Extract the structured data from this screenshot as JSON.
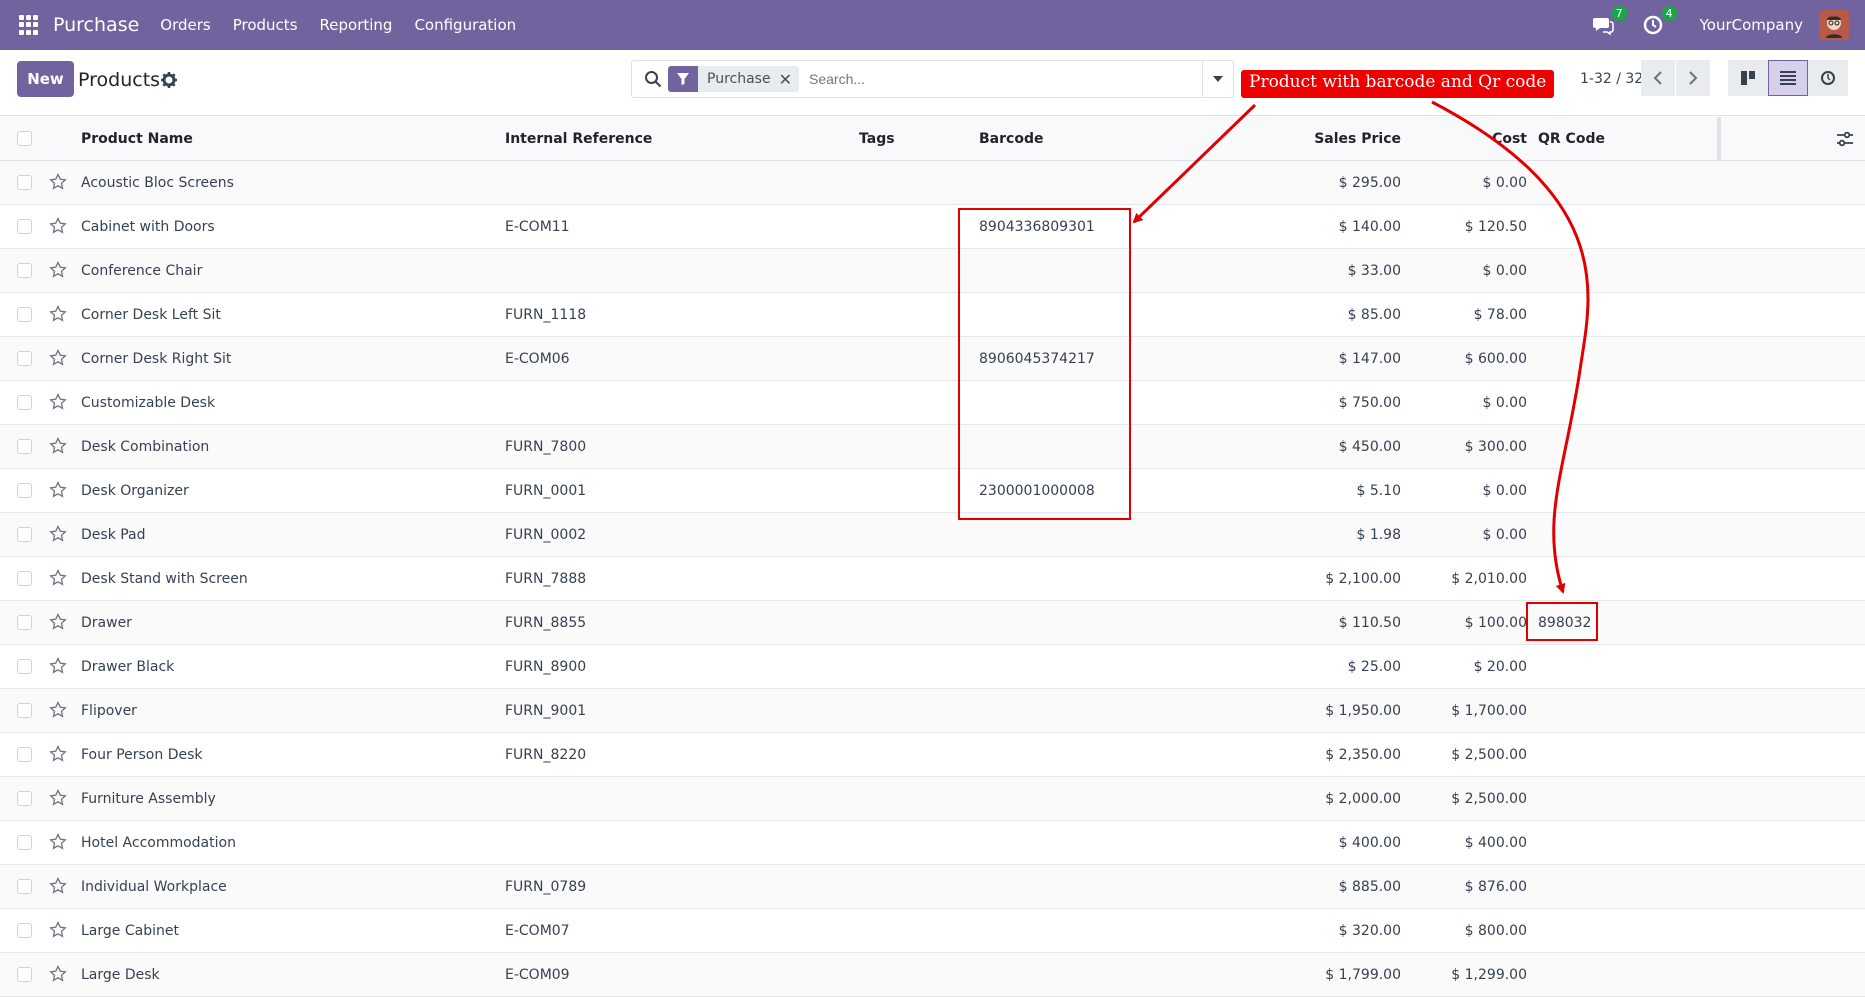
{
  "navbar": {
    "app_name": "Purchase",
    "menus": [
      "Orders",
      "Products",
      "Reporting",
      "Configuration"
    ],
    "messages_count": "7",
    "activities_count": "4",
    "company": "YourCompany"
  },
  "control": {
    "new_label": "New",
    "title": "Products",
    "facet_label": "Purchase",
    "search_placeholder": "Search...",
    "pager": "1-32 / 32"
  },
  "columns": {
    "name": "Product Name",
    "ref": "Internal Reference",
    "tags": "Tags",
    "barcode": "Barcode",
    "price": "Sales Price",
    "cost": "Cost",
    "qr": "QR Code"
  },
  "annotation": {
    "callout": "Product with barcode and Qr code"
  },
  "rows": [
    {
      "name": "Acoustic Bloc Screens",
      "ref": "",
      "barcode": "",
      "price": "$ 295.00",
      "cost": "$ 0.00",
      "qr": ""
    },
    {
      "name": "Cabinet with Doors",
      "ref": "E-COM11",
      "barcode": "8904336809301",
      "price": "$ 140.00",
      "cost": "$ 120.50",
      "qr": ""
    },
    {
      "name": "Conference Chair",
      "ref": "",
      "barcode": "",
      "price": "$ 33.00",
      "cost": "$ 0.00",
      "qr": ""
    },
    {
      "name": "Corner Desk Left Sit",
      "ref": "FURN_1118",
      "barcode": "",
      "price": "$ 85.00",
      "cost": "$ 78.00",
      "qr": ""
    },
    {
      "name": "Corner Desk Right Sit",
      "ref": "E-COM06",
      "barcode": "8906045374217",
      "price": "$ 147.00",
      "cost": "$ 600.00",
      "qr": ""
    },
    {
      "name": "Customizable Desk",
      "ref": "",
      "barcode": "",
      "price": "$ 750.00",
      "cost": "$ 0.00",
      "qr": ""
    },
    {
      "name": "Desk Combination",
      "ref": "FURN_7800",
      "barcode": "",
      "price": "$ 450.00",
      "cost": "$ 300.00",
      "qr": ""
    },
    {
      "name": "Desk Organizer",
      "ref": "FURN_0001",
      "barcode": "2300001000008",
      "price": "$ 5.10",
      "cost": "$ 0.00",
      "qr": ""
    },
    {
      "name": "Desk Pad",
      "ref": "FURN_0002",
      "barcode": "",
      "price": "$ 1.98",
      "cost": "$ 0.00",
      "qr": ""
    },
    {
      "name": "Desk Stand with Screen",
      "ref": "FURN_7888",
      "barcode": "",
      "price": "$ 2,100.00",
      "cost": "$ 2,010.00",
      "qr": ""
    },
    {
      "name": "Drawer",
      "ref": "FURN_8855",
      "barcode": "",
      "price": "$ 110.50",
      "cost": "$ 100.00",
      "qr": "898032"
    },
    {
      "name": "Drawer Black",
      "ref": "FURN_8900",
      "barcode": "",
      "price": "$ 25.00",
      "cost": "$ 20.00",
      "qr": ""
    },
    {
      "name": "Flipover",
      "ref": "FURN_9001",
      "barcode": "",
      "price": "$ 1,950.00",
      "cost": "$ 1,700.00",
      "qr": ""
    },
    {
      "name": "Four Person Desk",
      "ref": "FURN_8220",
      "barcode": "",
      "price": "$ 2,350.00",
      "cost": "$ 2,500.00",
      "qr": ""
    },
    {
      "name": "Furniture Assembly",
      "ref": "",
      "barcode": "",
      "price": "$ 2,000.00",
      "cost": "$ 2,500.00",
      "qr": ""
    },
    {
      "name": "Hotel Accommodation",
      "ref": "",
      "barcode": "",
      "price": "$ 400.00",
      "cost": "$ 400.00",
      "qr": ""
    },
    {
      "name": "Individual Workplace",
      "ref": "FURN_0789",
      "barcode": "",
      "price": "$ 885.00",
      "cost": "$ 876.00",
      "qr": ""
    },
    {
      "name": "Large Cabinet",
      "ref": "E-COM07",
      "barcode": "",
      "price": "$ 320.00",
      "cost": "$ 800.00",
      "qr": ""
    },
    {
      "name": "Large Desk",
      "ref": "E-COM09",
      "barcode": "",
      "price": "$ 1,799.00",
      "cost": "$ 1,299.00",
      "qr": ""
    }
  ]
}
